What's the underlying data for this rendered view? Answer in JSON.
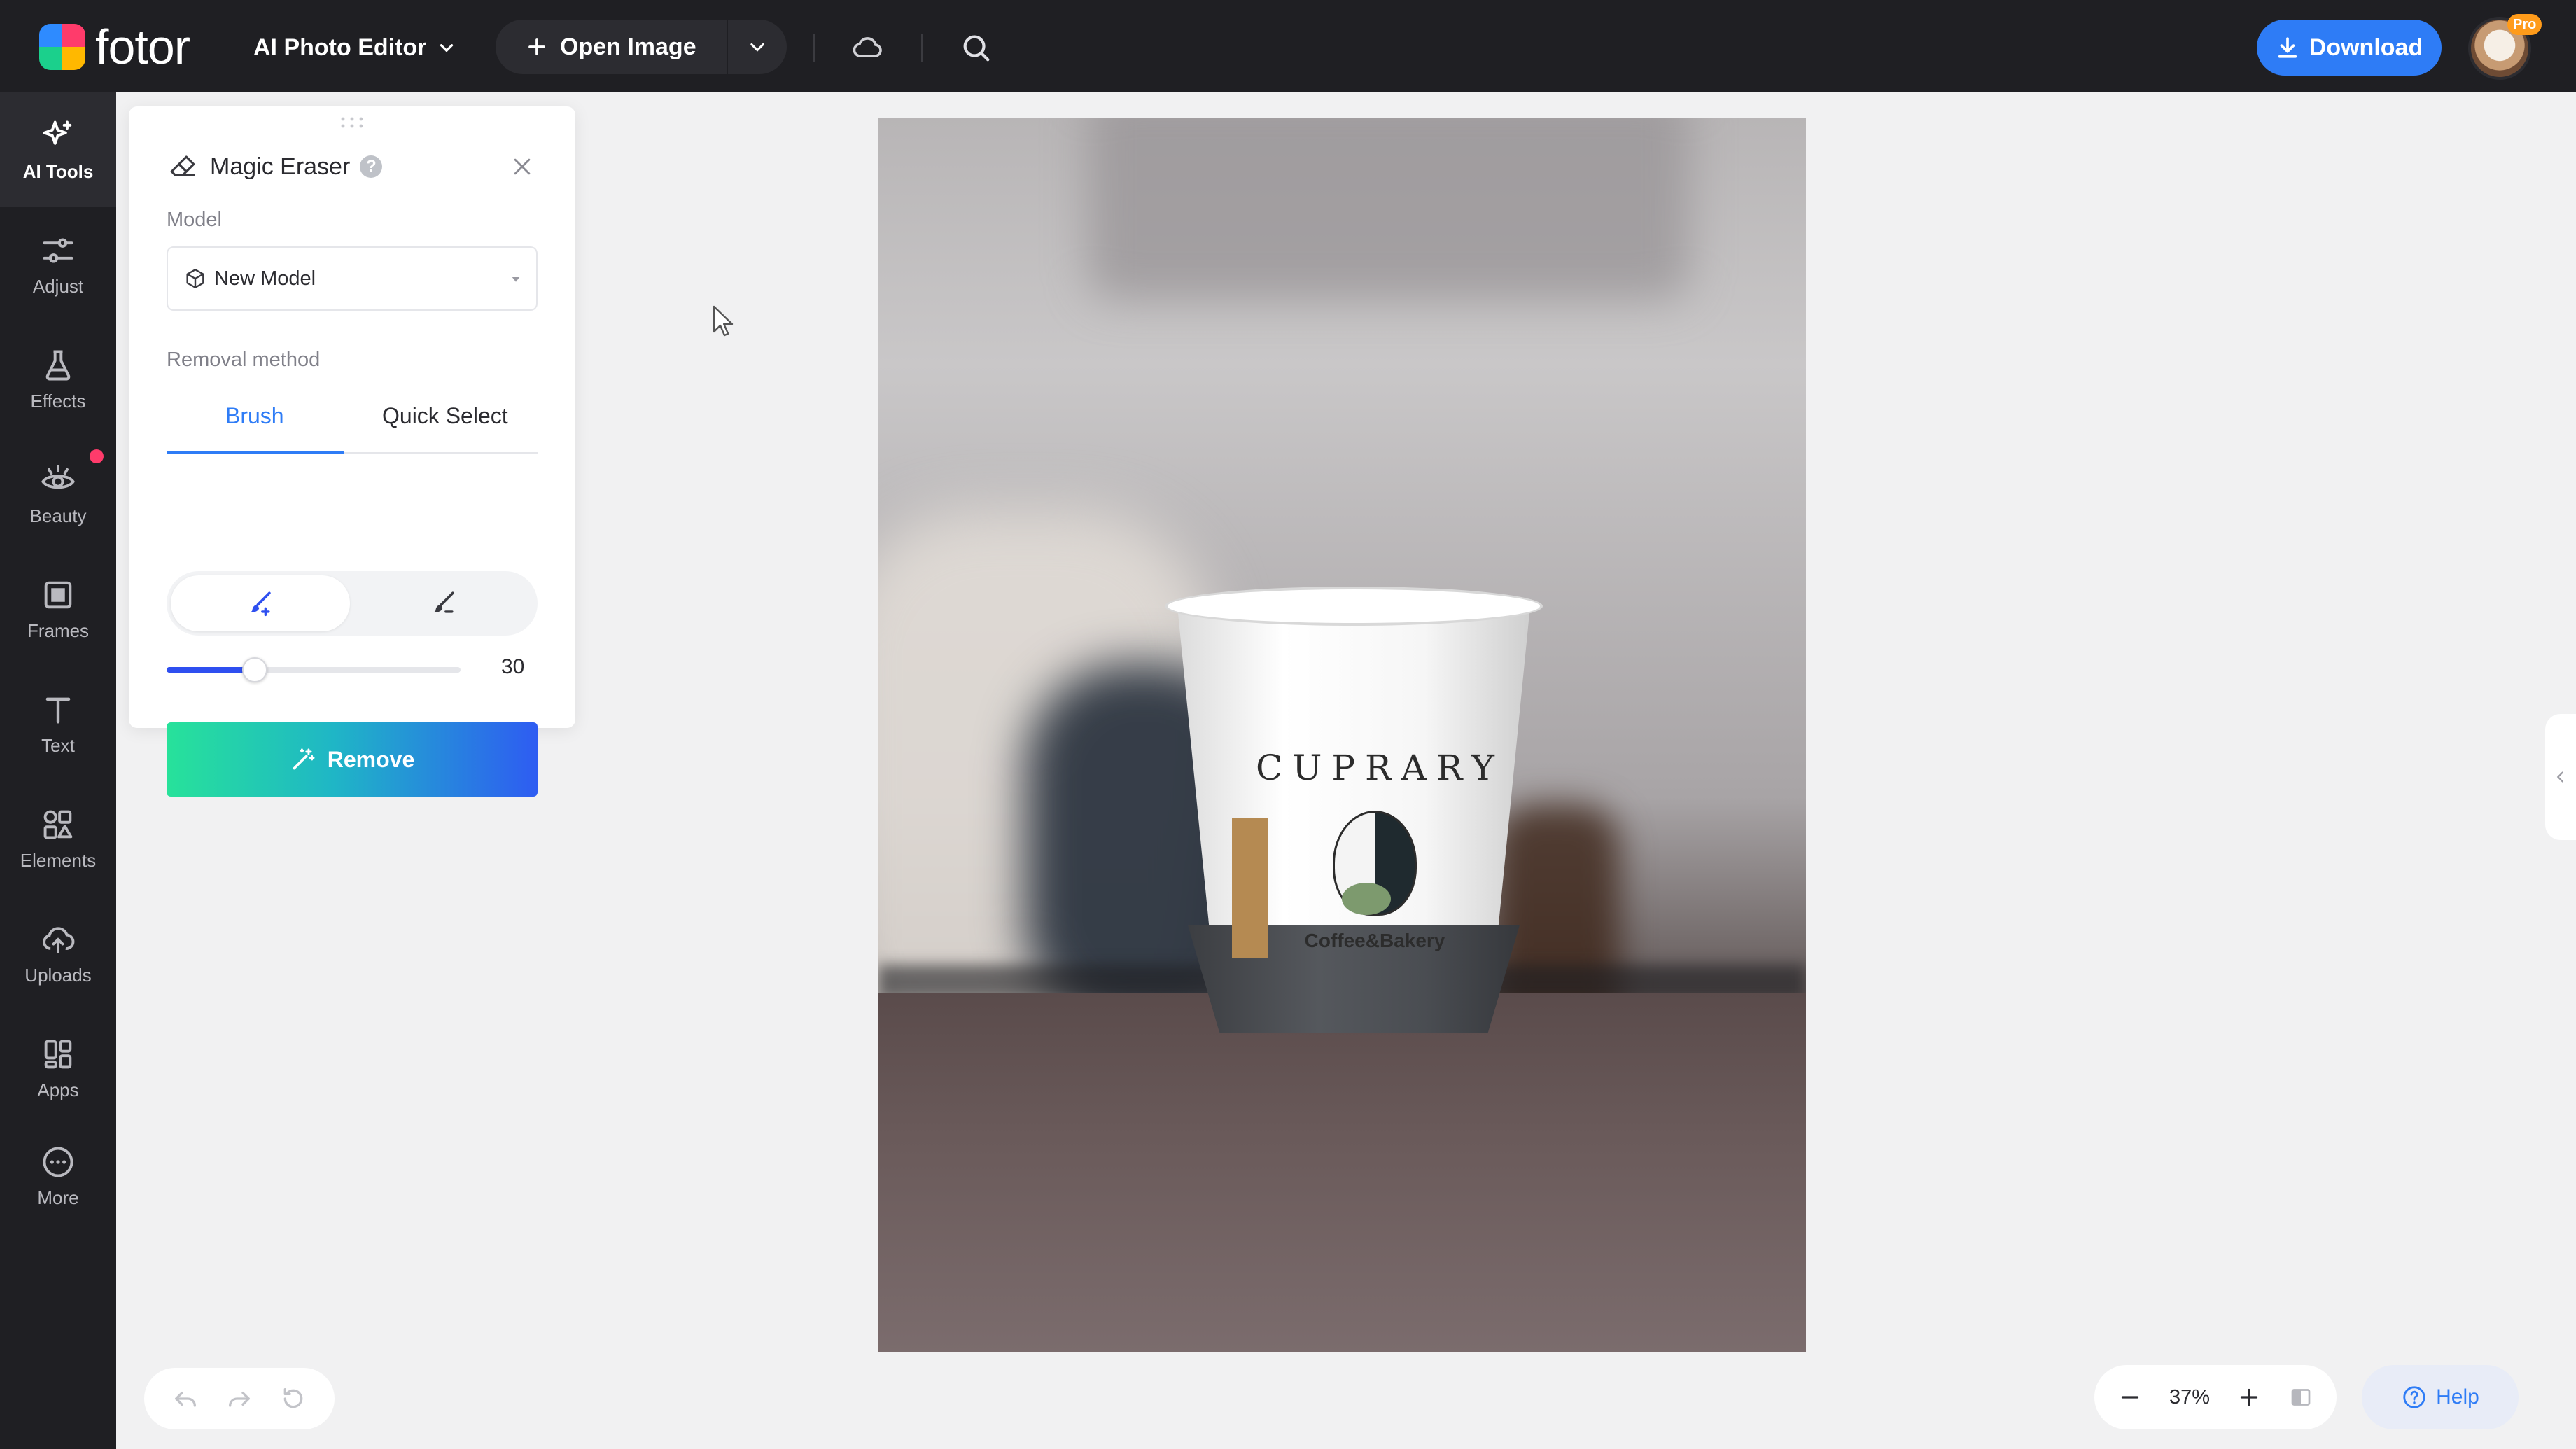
{
  "header": {
    "logo_text": "fotor",
    "app_switch_label": "AI Photo Editor",
    "open_image_label": "Open Image",
    "download_label": "Download",
    "pro_badge": "Pro"
  },
  "sidebar": {
    "items": [
      {
        "label": "AI Tools",
        "icon": "sparkle-icon",
        "active": true
      },
      {
        "label": "Adjust",
        "icon": "sliders-icon"
      },
      {
        "label": "Effects",
        "icon": "flask-icon"
      },
      {
        "label": "Beauty",
        "icon": "eye-icon",
        "badge": true
      },
      {
        "label": "Frames",
        "icon": "frame-icon"
      },
      {
        "label": "Text",
        "icon": "text-icon"
      },
      {
        "label": "Elements",
        "icon": "shapes-icon"
      },
      {
        "label": "Uploads",
        "icon": "cloud-upload-icon"
      },
      {
        "label": "Apps",
        "icon": "apps-icon"
      },
      {
        "label": "More",
        "icon": "more-icon"
      }
    ]
  },
  "panel": {
    "title": "Magic Eraser",
    "help": "?",
    "model_label": "Model",
    "model_value": "New Model",
    "removal_label": "Removal method",
    "tabs": [
      {
        "label": "Brush",
        "active": true
      },
      {
        "label": "Quick Select",
        "active": false
      }
    ],
    "brush_size": 30,
    "brush_size_max": 100,
    "remove_label": "Remove"
  },
  "canvas": {
    "cup_brand": "CUPRARY",
    "cup_subtitle": "Coffee&Bakery"
  },
  "footer": {
    "zoom": "37%",
    "help_label": "Help"
  },
  "colors": {
    "accent": "#2e7cf6",
    "topbar": "#1f1f23",
    "remove_gradient_start": "#27e29a",
    "remove_gradient_end": "#2e5cf2"
  }
}
